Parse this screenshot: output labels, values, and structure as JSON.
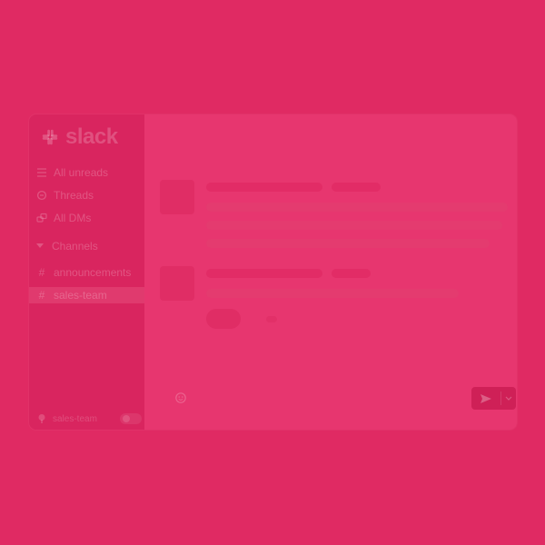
{
  "app": {
    "brand": "slack"
  },
  "sidebar": {
    "items": [
      {
        "label": "All unreads",
        "icon": "list-icon"
      },
      {
        "label": "Threads",
        "icon": "threads-icon"
      },
      {
        "label": "All DMs",
        "icon": "dms-icon"
      }
    ],
    "channels_header": "Channels",
    "channels": [
      {
        "label": "announcements",
        "selected": false
      },
      {
        "label": "sales-team",
        "selected": true
      }
    ],
    "workspace": {
      "label": "sales-team",
      "toggle_on": false
    }
  },
  "composer": {
    "emoji_icon": "emoji-icon",
    "send_icon": "send-icon",
    "menu_icon": "chevron-down-icon"
  },
  "colors": {
    "background": "#E02A63",
    "sidebar": "#D9255F",
    "main": "#E7366F",
    "selected_channel": "#E03A6E"
  }
}
